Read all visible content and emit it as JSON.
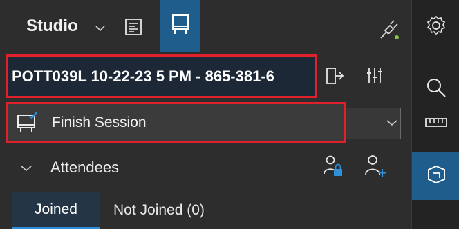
{
  "header": {
    "title": "Studio",
    "chevron_icon": "chevron-down-icon",
    "notes_icon": "notes-icon",
    "whiteboard_icon": "whiteboard-icon",
    "connection_icon": "plug-disconnected-icon"
  },
  "session": {
    "name": "POTT039L 10-22-23 5 PM - 865-381-6",
    "exit_icon": "exit-icon",
    "mixer_icon": "mixer-icon"
  },
  "finish": {
    "label": "Finish Session",
    "icon": "finish-session-icon"
  },
  "attendees": {
    "label": "Attendees",
    "lock_icon": "lock-user-icon",
    "add_icon": "add-user-icon"
  },
  "tabs": [
    {
      "label": "Joined",
      "selected": true
    },
    {
      "label": "Not Joined (0)",
      "selected": false
    }
  ],
  "rail": {
    "items": [
      "settings-icon",
      "search-icon",
      "ruler-icon",
      "shape-icon"
    ]
  },
  "colors": {
    "highlight_border": "#e0202a",
    "accent": "#1f5d8c",
    "tab_underline": "#2f8fd8",
    "status_green": "#8bc34a"
  }
}
